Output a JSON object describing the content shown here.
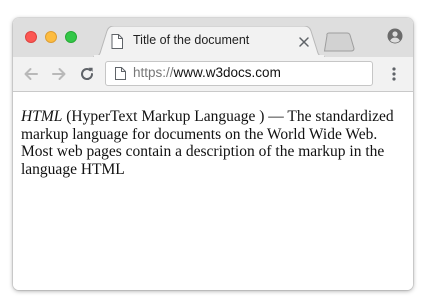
{
  "tab": {
    "title": "Title of the document",
    "doc_icon": "document-icon",
    "close_icon": "close-icon"
  },
  "toolbar": {
    "back_icon": "back-arrow-icon",
    "forward_icon": "forward-arrow-icon",
    "reload_icon": "reload-icon",
    "page_icon": "document-icon",
    "url_scheme": "https://",
    "url_host": "www.w3docs.com",
    "menu_icon": "kebab-menu-icon"
  },
  "window": {
    "profile_icon": "account-icon",
    "newtab_icon": "new-tab-icon"
  },
  "content": {
    "term": "HTML",
    "text": " (HyperText Markup Language ) — The standardized markup language for documents on the World Wide Web. Most web pages contain a description of the markup in the language HTML"
  },
  "colors": {
    "close": "#fc5753",
    "minimize": "#fdbc40",
    "zoom": "#33c748",
    "titlebar": "#dedede",
    "toolbar": "#f2f2f2"
  }
}
